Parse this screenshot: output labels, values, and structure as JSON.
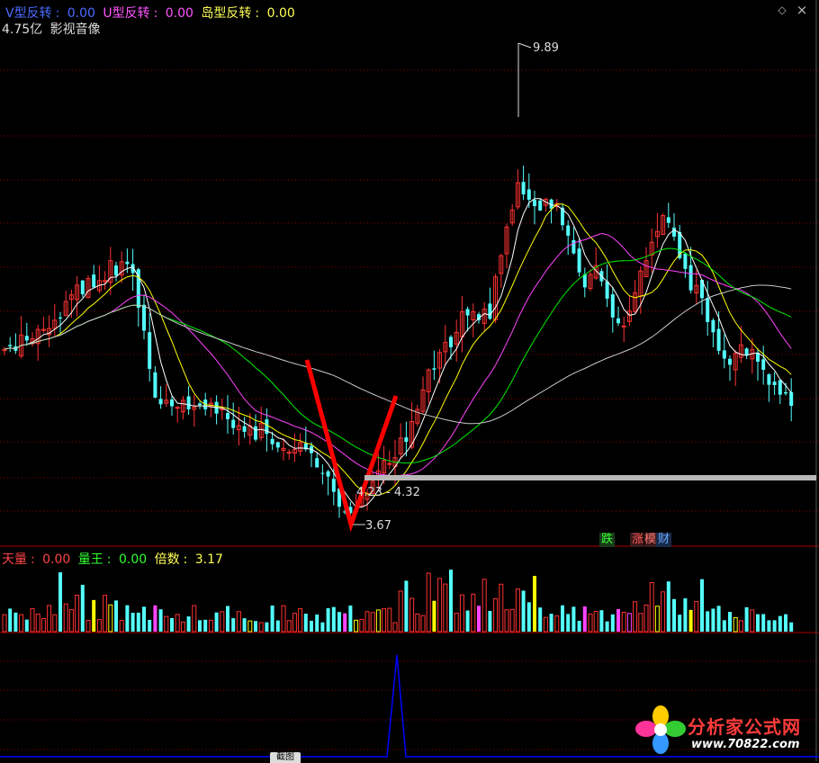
{
  "header": {
    "v_label": "V型反转",
    "v_value": "0.00",
    "u_label": "U型反转",
    "u_value": "0.00",
    "island_label": "岛型反转",
    "island_value": "0.00",
    "market_cap": "4.75亿",
    "concept": "影视音像",
    "controls": [
      "diamond-icon",
      "close-icon"
    ]
  },
  "price_panel": {
    "high_label": "9.89",
    "low_label": "3.67",
    "range_label": "4.23 - 4.32",
    "badge_down": "跌",
    "badge_up": "涨",
    "badge_model": "模",
    "badge_finance": "财"
  },
  "volume_panel": {
    "tianliang_label": "天量",
    "tianliang_value": "0.00",
    "liangwang_label": "量王",
    "liangwang_value": "0.00",
    "beishu_label": "倍数",
    "beishu_value": "3.17"
  },
  "watermark": {
    "title": "分析家公式网",
    "url": "www.70822.com"
  },
  "crop_tab": "截图",
  "colors": {
    "up": "#ff3232",
    "down": "#54ffff",
    "ma5": "#ffffff",
    "ma10": "#ffff00",
    "ma20": "#ff44ff",
    "ma30": "#00ee00",
    "ma60": "#c8c8c8",
    "v_signal": "#ff0000",
    "grid": "#8b0000",
    "indicator": "#0000ff"
  },
  "chart_data": {
    "type": "candlestick",
    "price_high": 9.89,
    "price_low": 3.67,
    "range_low": 4.23,
    "range_high": 4.32,
    "indicator_values": {
      "天量": 0.0,
      "量王": 0.0,
      "倍数": 3.17
    }
  }
}
